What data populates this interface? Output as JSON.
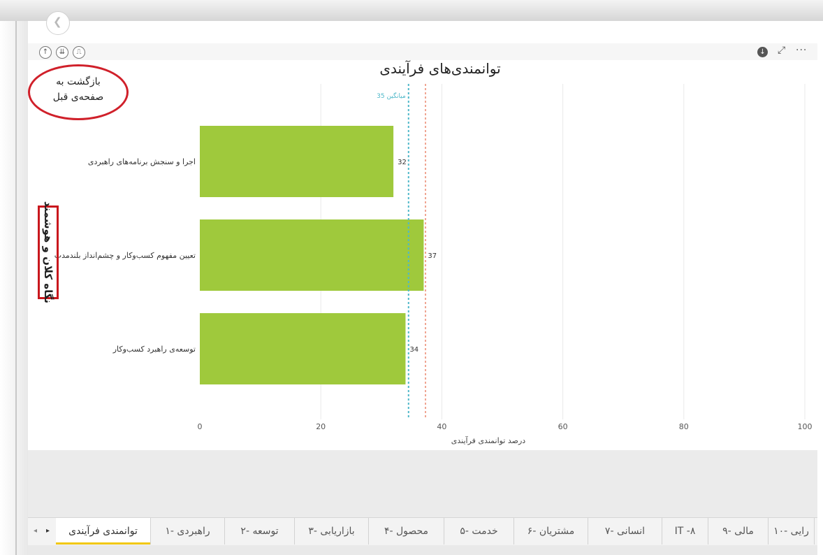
{
  "toolbar": {
    "left_icons": [
      "drill-up-icon",
      "expand-down-icon",
      "drill-mode-icon"
    ],
    "right_icons": [
      "download-icon",
      "focus-mode-icon",
      "more-options-icon"
    ],
    "more_label": "···"
  },
  "annotation": {
    "text_line1": "بازگشت به",
    "text_line2": "صفحه‌ی قبل"
  },
  "y_axis_title": "نگاه کلان و هوشمند",
  "chart_data": {
    "type": "bar",
    "orientation": "horizontal",
    "title": "توانمندی‌های فرآیندی",
    "xlabel": "درصد توانمندی فرآیندی",
    "categories": [
      "اجرا و سنجش برنامه‌های راهبردی",
      "تعیین مفهوم کسب‌وکار و چشم‌انداز بلندمدت",
      "توسعه‌ی راهبرد کسب‌وکار"
    ],
    "values": [
      32,
      37,
      34
    ],
    "data_labels": [
      "32",
      "37",
      "34"
    ],
    "xlim": [
      0,
      100
    ],
    "xticks": [
      0,
      20,
      40,
      60,
      80,
      100
    ],
    "xtick_labels": [
      "0",
      "20",
      "40",
      "60",
      "80",
      "100"
    ],
    "bar_color": "#9fc93c",
    "reference_lines": [
      {
        "label": "میانگین 35",
        "value": 34.5,
        "color": "#4fb8c9"
      },
      {
        "label": "",
        "value": 37.3,
        "color": "#f0a592"
      }
    ],
    "grid": true
  },
  "tabs": [
    {
      "label": "توانمندی فرآیندی",
      "active": true
    },
    {
      "label": "راهبردی -۱",
      "active": false
    },
    {
      "label": "توسعه -۲",
      "active": false
    },
    {
      "label": "بازاریابی -۳",
      "active": false
    },
    {
      "label": "محصول -۴",
      "active": false
    },
    {
      "label": "خدمت -۵",
      "active": false
    },
    {
      "label": "مشتریان -۶",
      "active": false
    },
    {
      "label": "انسانی -۷",
      "active": false
    },
    {
      "label": "IT -۸",
      "active": false
    },
    {
      "label": "مالی -۹",
      "active": false
    },
    {
      "label": "رایی -۱۰",
      "active": false
    }
  ],
  "nav": {
    "prev": "◂",
    "next": "▸"
  },
  "colors": {
    "accent_tab": "#f2c811",
    "annotation_red": "#d0202a"
  }
}
